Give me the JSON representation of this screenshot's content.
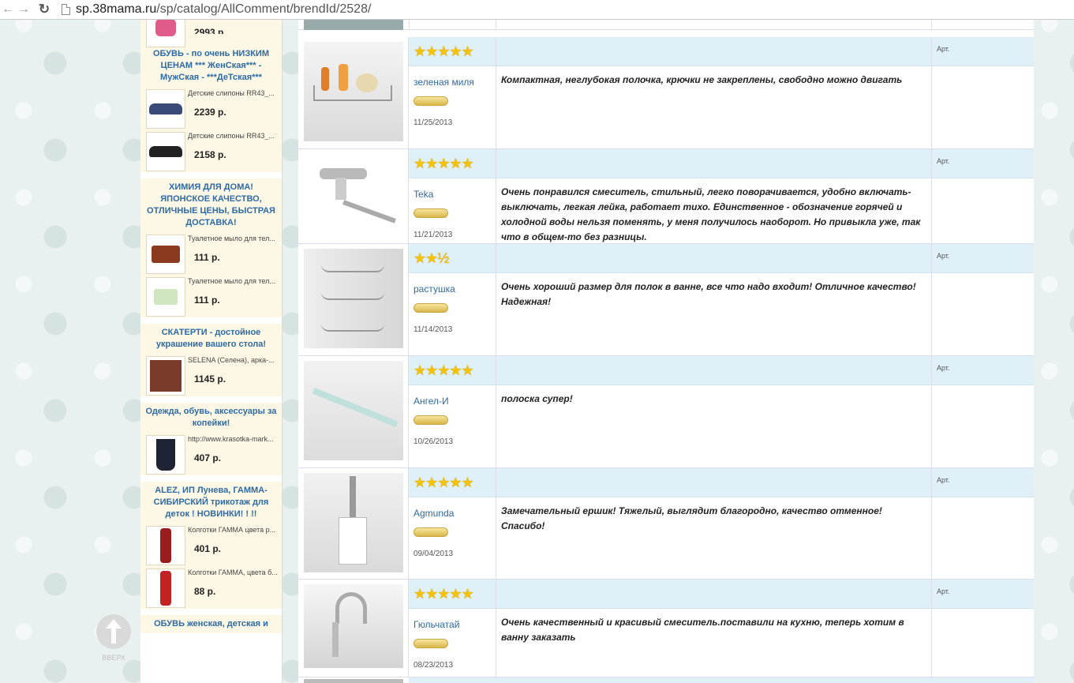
{
  "browser": {
    "url_domain": "sp.38mama.ru",
    "url_path": "/sp/catalog/AllComment/brendId/2528/"
  },
  "sidebar": {
    "top_price": "2993 р.",
    "blocks": [
      {
        "title": "ОБУВЬ - по очень НИЗКИМ ЦЕНАМ *** ЖенСкая*** - МужСкая - ***ДеТская***",
        "items": [
          {
            "name": "Детские слипоны RR43_...",
            "price": "2239 р."
          },
          {
            "name": "Детские слипоны RR43_...",
            "price": "2158 р."
          }
        ]
      },
      {
        "title": "ХИМИЯ ДЛЯ ДОМА! ЯПОНСКОЕ КАЧЕСТВО, ОТЛИЧНЫЕ ЦЕНЫ, БЫСТРАЯ ДОСТАВКА!",
        "items": [
          {
            "name": "Туалетное мыло для тел...",
            "price": "111 р."
          },
          {
            "name": "Туалетное мыло для тел...",
            "price": "111 р."
          }
        ]
      },
      {
        "title": "СКАТЕРТИ - достойное украшение вашего стола!",
        "items": [
          {
            "name": "SELENA (Селена), арка-...",
            "price": "1145 р."
          }
        ]
      },
      {
        "title": "Одежда, обувь, аксессуары за копейки!",
        "items": [
          {
            "name": "http://www.krasotka-mark...",
            "price": "407 р."
          }
        ]
      },
      {
        "title": "ALEZ, ИП Лунева, ГАММА-СИБИРСКИЙ трикотаж для деток ! НОВИНКИ! ! !!",
        "items": [
          {
            "name": "Колготки ГАММА цвета р...",
            "price": "401 р."
          },
          {
            "name": "Колготки ГАММА, цвета б...",
            "price": "88 р."
          }
        ]
      },
      {
        "title": "ОБУВЬ женская, детская и"
      }
    ],
    "up_label": "ВВЕРХ"
  },
  "reviews": [
    {
      "stars": 5,
      "stars_text": "★★★★★",
      "user": "зеленая миля",
      "date": "11/25/2013",
      "art": "Арт.",
      "text": "Компактная, неглубокая полочка, крючки не закреплены, свободно можно двигать"
    },
    {
      "stars": 5,
      "stars_text": "★★★★★",
      "user": "Teka",
      "date": "11/21/2013",
      "art": "Арт.",
      "text": "Очень понравился смеситель, стильный, легко поворачивается, удобно включать-выключать, легкая лейка, работает тихо. Единственное - обозначение горячей и холодной воды нельзя поменять, у меня получилось наоборот. Но привыкла уже, так что в общем-то без разницы."
    },
    {
      "stars": 2.5,
      "stars_text": "★★½",
      "user": "растушка",
      "date": "11/14/2013",
      "art": "Арт.",
      "text": "Очень хороший размер для полок в ванне, все что надо входит! Отличное качество! Надежная!"
    },
    {
      "stars": 5,
      "stars_text": "★★★★★",
      "user": "Ангел-И",
      "date": "10/26/2013",
      "art": "Арт.",
      "text": "полоска супер!"
    },
    {
      "stars": 5,
      "stars_text": "★★★★★",
      "user": "Agmunda",
      "date": "09/04/2013",
      "art": "Арт.",
      "text": "Замечательный ершик! Тяжелый, выглядит благородно, качество отменное! Спасибо!"
    },
    {
      "stars": 5,
      "stars_text": "★★★★★",
      "user": "Гюльчатай",
      "date": "08/23/2013",
      "art": "Арт.",
      "text": "Очень качественный и красивый смеситель.поставили на кухню, теперь хотим в ванну заказать"
    }
  ]
}
